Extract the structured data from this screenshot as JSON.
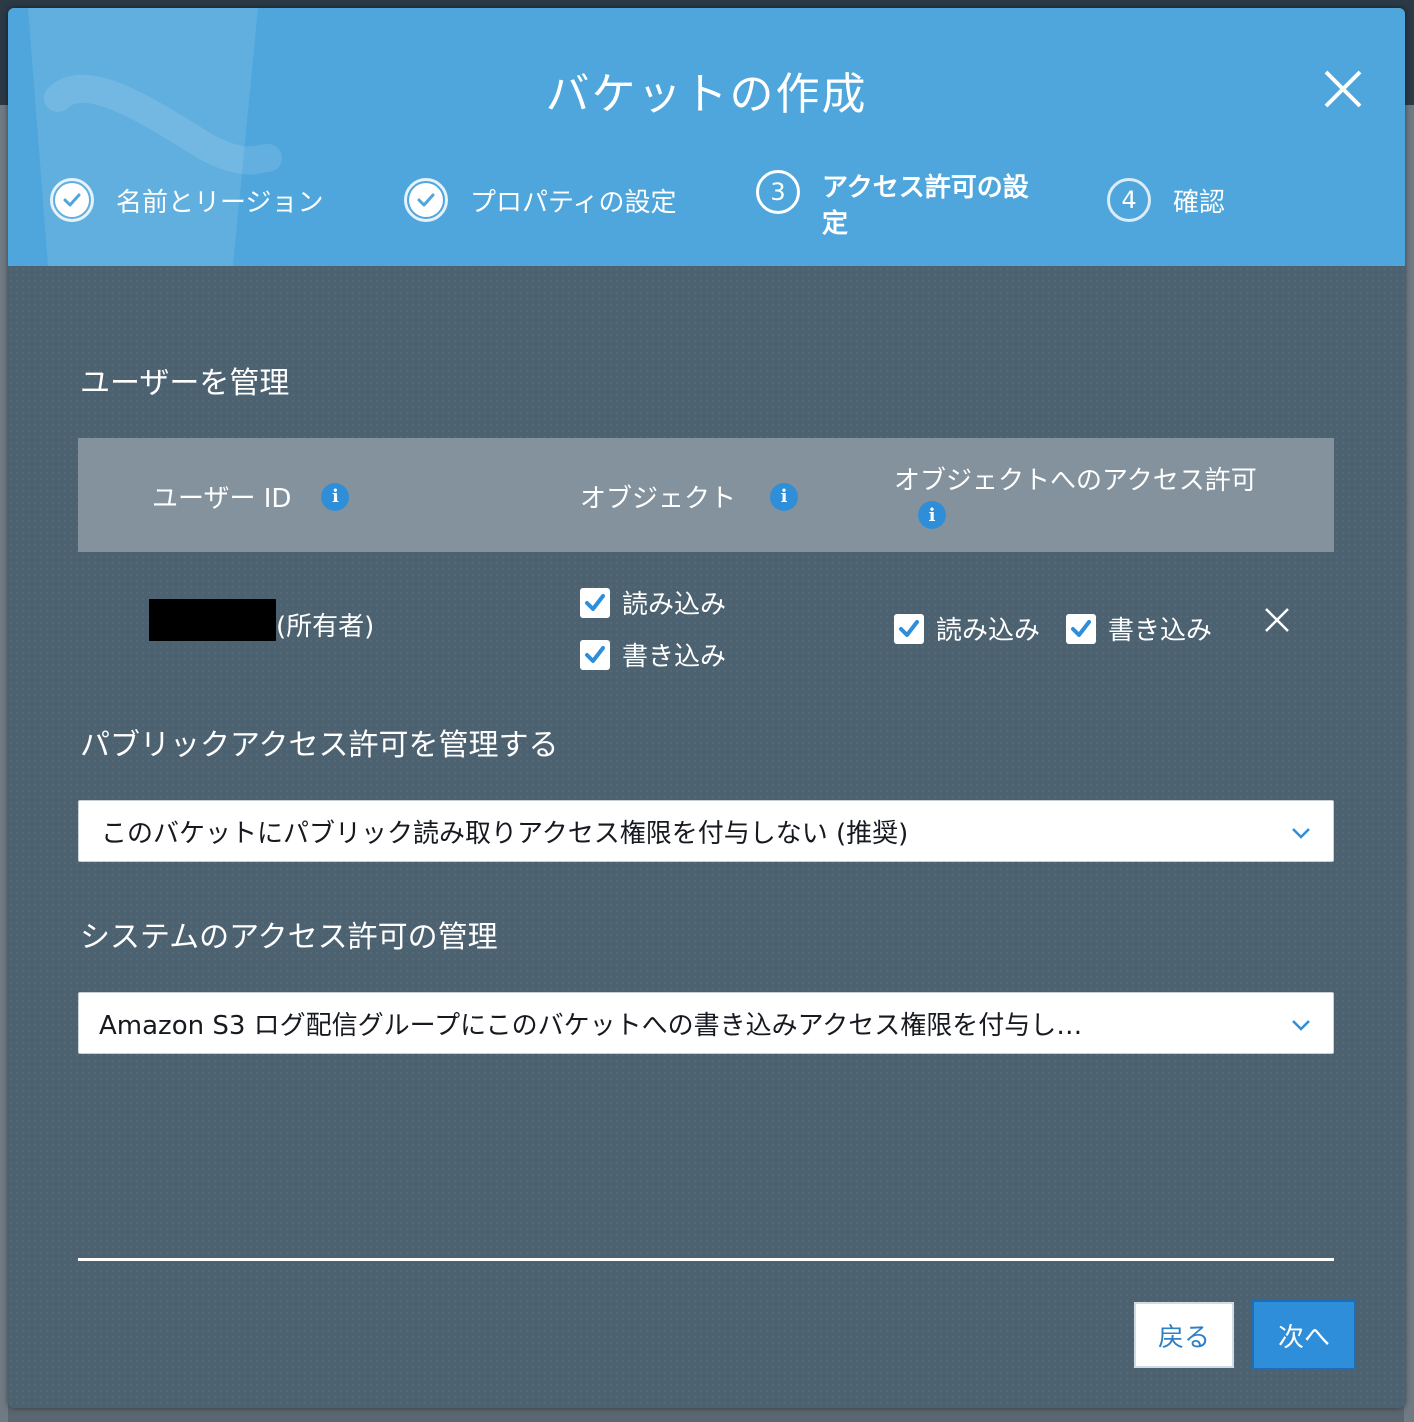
{
  "modal": {
    "title": "バケットの作成",
    "close_icon": "close-icon"
  },
  "steps": [
    {
      "number": "",
      "label": "名前とリージョン",
      "state": "done"
    },
    {
      "number": "",
      "label": "プロパティの設定",
      "state": "done"
    },
    {
      "number": "3",
      "label": "アクセス許可の設定",
      "label_line1": "アクセス許可の設",
      "label_line2": "定",
      "state": "active"
    },
    {
      "number": "4",
      "label": "確認",
      "state": "pending"
    }
  ],
  "users": {
    "title": "ユーザーを管理",
    "columns": {
      "user_id": "ユーザー ID",
      "object": "オブジェクト",
      "object_permissions": "オブジェクトへのアクセス許可"
    },
    "rows": [
      {
        "owner_label": "(所有者)",
        "object_read": "読み込み",
        "object_write": "書き込み",
        "perm_read": "読み込み",
        "perm_write": "書き込み"
      }
    ]
  },
  "public_access": {
    "title": "パブリックアクセス許可を管理する",
    "selected": "このバケットにパブリック読み取りアクセス権限を付与しない (推奨)"
  },
  "system_access": {
    "title": "システムのアクセス許可の管理",
    "selected": "Amazon S3 ログ配信グループにこのバケットへの書き込みアクセス権限を付与し…"
  },
  "footer": {
    "back_label": "戻る",
    "next_label": "次へ"
  },
  "colors": {
    "header": "#4ea6dc",
    "body": "#4d6270",
    "table_header": "#83929c",
    "accent": "#2f8ed9",
    "info_icon": "#2e8fd8"
  }
}
